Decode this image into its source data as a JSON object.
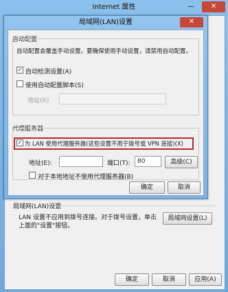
{
  "outer_window": {
    "title": "Internet 属性",
    "minimize": "—",
    "close": "✕"
  },
  "lan_section": {
    "title": "局域网(LAN)设置",
    "description_line1": "LAN 设置不应用到拨号连接。对于拨号设置，单击",
    "description_line2": "上面的\"设置\"按钮。",
    "lan_settings_button": "局域网设置(L)"
  },
  "outer_buttons": {
    "ok": "确定",
    "cancel": "取消",
    "apply": "应用(A)"
  },
  "dialog": {
    "title": "局域网(LAN)设置",
    "close": "✕",
    "auto_config": {
      "legend": "自动配置",
      "description": "自动配置会覆盖手动设置。要确保使用手动设置，请禁用自动配置。",
      "auto_detect_label": "自动检测设置(A)",
      "auto_detect_checked": true,
      "use_script_label": "使用自动配置脚本(S)",
      "use_script_checked": false,
      "address_label": "地址(R)",
      "address_value": ""
    },
    "proxy": {
      "legend": "代理服务器",
      "use_proxy_label": "为 LAN 使用代理服务器(这些设置不用于拨号或 VPN 连接)(X)",
      "use_proxy_checked": true,
      "address_label": "地址(E):",
      "address_value": "",
      "port_label": "端口(T):",
      "port_value": "80",
      "advanced_button": "高级(C)",
      "bypass_label": "对于本地地址不使用代理服务器(B)",
      "bypass_checked": false
    },
    "ok": "确定",
    "cancel": "取消"
  },
  "icons": {
    "checkmark": "✓"
  }
}
